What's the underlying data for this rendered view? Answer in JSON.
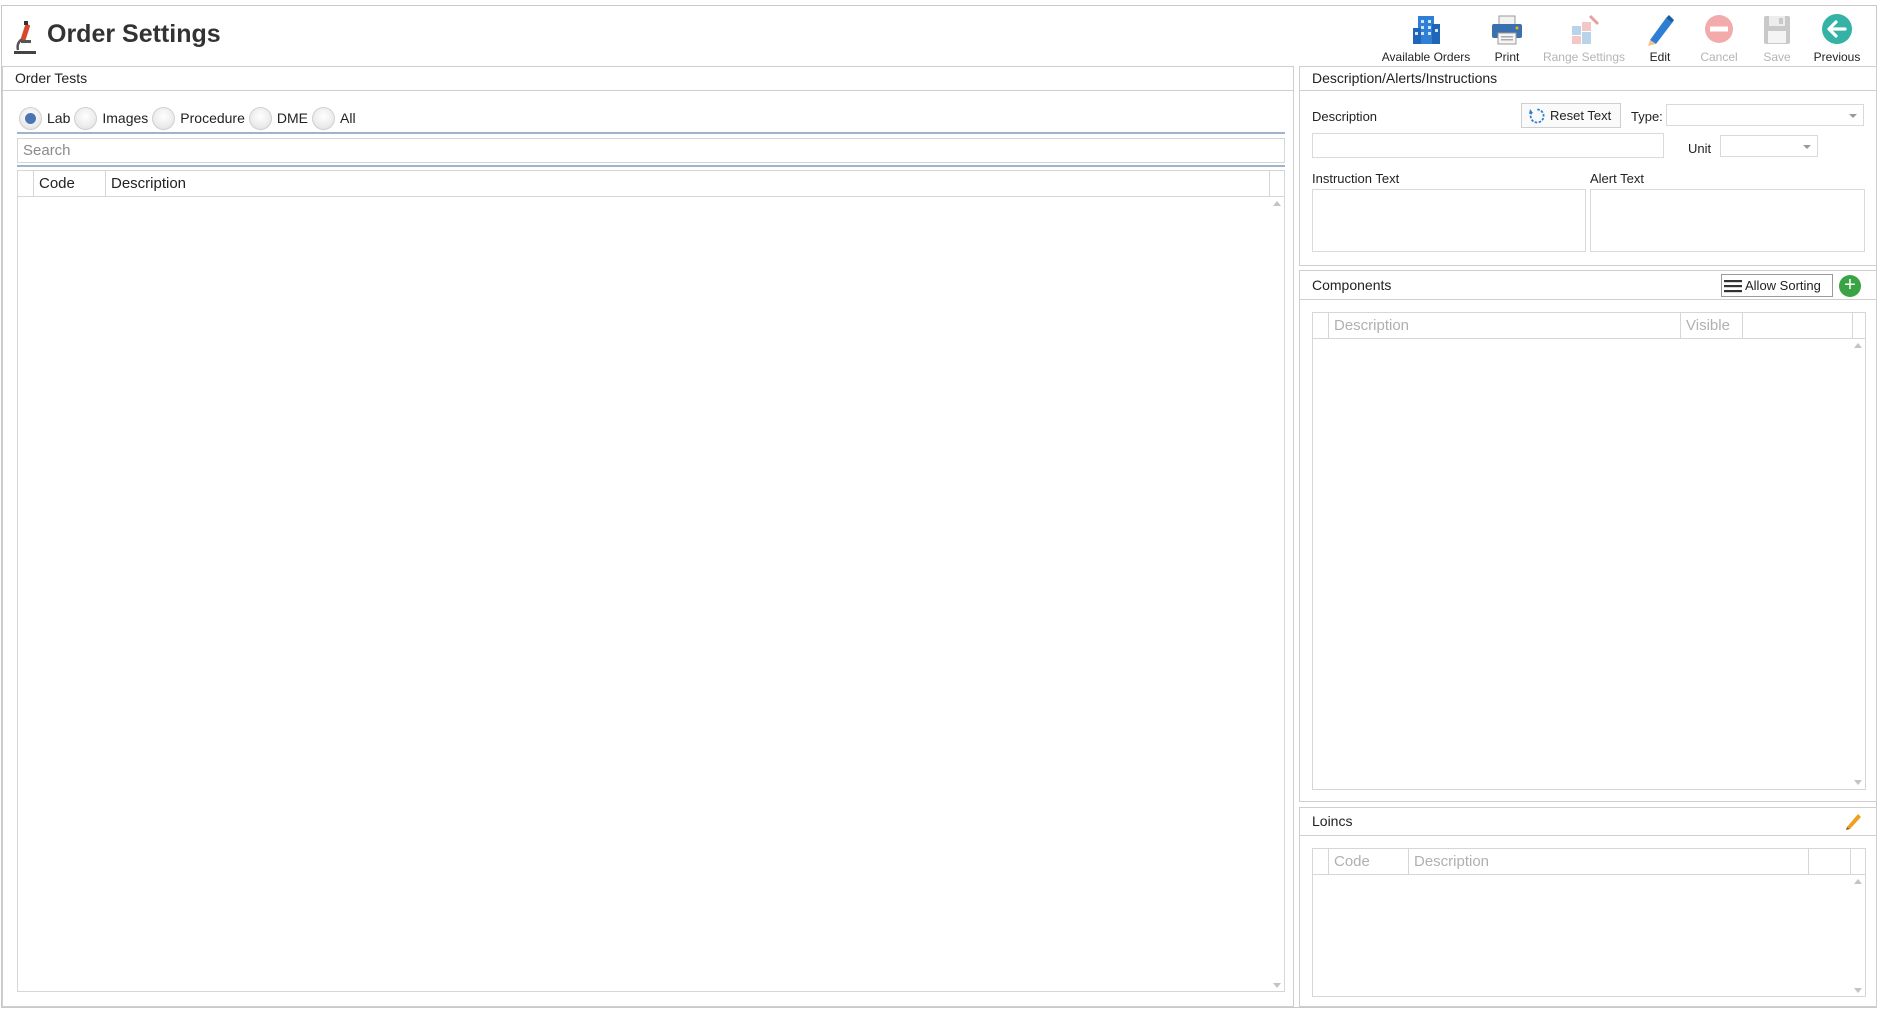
{
  "header": {
    "title": "Order Settings"
  },
  "toolbar": {
    "available_orders": "Available Orders",
    "print": "Print",
    "range_settings": "Range Settings",
    "edit": "Edit",
    "cancel": "Cancel",
    "save": "Save",
    "previous": "Previous"
  },
  "order_tests": {
    "title": "Order Tests",
    "filters": [
      {
        "label": "Lab",
        "selected": true
      },
      {
        "label": "Images",
        "selected": false
      },
      {
        "label": "Procedure",
        "selected": false
      },
      {
        "label": "DME",
        "selected": false
      },
      {
        "label": "All",
        "selected": false
      }
    ],
    "search": {
      "placeholder": "Search",
      "value": ""
    },
    "columns": {
      "code": "Code",
      "description": "Description"
    },
    "rows": []
  },
  "description_panel": {
    "title": "Description/Alerts/Instructions",
    "description_label": "Description",
    "reset_text": "Reset Text",
    "type_label": "Type:",
    "type_value": "",
    "unit_label": "Unit",
    "unit_value": "",
    "instruction_label": "Instruction Text",
    "alert_label": "Alert Text"
  },
  "components": {
    "title": "Components",
    "allow_sorting": "Allow Sorting",
    "add_label": "+",
    "columns": {
      "description": "Description",
      "visible": "Visible"
    },
    "rows": []
  },
  "loincs": {
    "title": "Loincs",
    "columns": {
      "code": "Code",
      "description": "Description"
    },
    "rows": []
  },
  "colors": {
    "accent": "#4a74b4",
    "add_green": "#3aa344",
    "disabled_text": "#b4b4b4"
  }
}
